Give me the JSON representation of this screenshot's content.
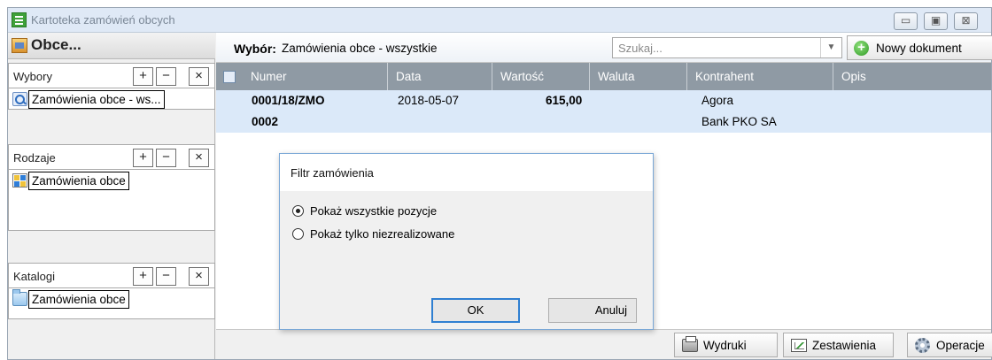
{
  "window": {
    "title": "Kartoteka zamówień obcych",
    "controls": {
      "minimize": "▭",
      "maximize": "▣",
      "close": "⊠"
    }
  },
  "sidebar": {
    "header_title": "Obce...",
    "sections": [
      {
        "title": "Wybory",
        "item": "Zamówienia obce - ws..."
      },
      {
        "title": "Rodzaje",
        "item": "Zamówienia obce"
      },
      {
        "title": "Katalogi",
        "item": "Zamówienia obce"
      }
    ],
    "buttons": {
      "add": "+",
      "remove": "−",
      "close": "×"
    }
  },
  "toolbar": {
    "selection_label": "Wybór:",
    "selection_value": "Zamówienia obce - wszystkie",
    "search_placeholder": "Szukaj...",
    "search_dropdown_icon": "chevron-down-icon",
    "new_document_label": "Nowy dokument"
  },
  "table": {
    "columns": [
      "Numer",
      "Data",
      "Wartość",
      "Waluta",
      "Kontrahent",
      "Opis"
    ],
    "rows": [
      {
        "numer": "0001/18/ZMO",
        "data": "2018-05-07",
        "wartosc": "615,00",
        "waluta": "",
        "kontrahent": "Agora",
        "opis": ""
      },
      {
        "numer": "0002",
        "data": "",
        "wartosc": "",
        "waluta": "",
        "kontrahent": "Bank PKO SA",
        "opis": ""
      }
    ]
  },
  "bottom_bar": {
    "print_label": "Wydruki",
    "reports_label": "Zestawienia",
    "operations_label": "Operacje"
  },
  "dialog": {
    "title": "Filtr zamówienia",
    "options": [
      {
        "label": "Pokaż wszystkie pozycje",
        "selected": true
      },
      {
        "label": "Pokaż tylko niezrealizowane",
        "selected": false
      }
    ],
    "ok_label": "OK",
    "cancel_label": "Anuluj"
  },
  "colors": {
    "grid_header": "#8f9aa4",
    "row_highlight": "#dbe9f9",
    "dialog_border": "#7aa7d6",
    "default_button_border": "#2f7fd1"
  }
}
